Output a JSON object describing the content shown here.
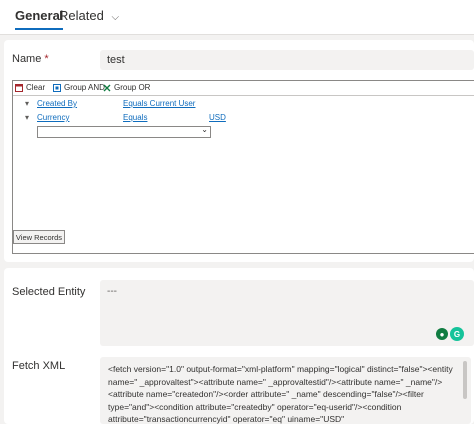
{
  "tabs": {
    "general": "General",
    "related": "Related",
    "related_chevron": "chevron-down-icon"
  },
  "name_field": {
    "label": "Name",
    "required_mark": "*",
    "value": "test"
  },
  "fetch_builder": {
    "toolbar": {
      "clear": "Clear",
      "group_and": "Group AND",
      "group_or": "Group OR"
    },
    "conditions": [
      {
        "field": "Created By",
        "operator": "Equals Current User",
        "value": ""
      },
      {
        "field": "Currency",
        "operator": "Equals",
        "value": "USD"
      }
    ],
    "view_records": "View Records"
  },
  "selected_entity": {
    "label": "Selected Entity",
    "value": "---"
  },
  "fetch_xml": {
    "label": "Fetch XML",
    "value": "<fetch version=\"1.0\" output-format=\"xml-platform\" mapping=\"logical\" distinct=\"false\"><entity name=\"      _approvaltest\"><attribute name=\"      _approvaltestid\"/><attribute name=\"      _name\"/><attribute name=\"createdon\"/><order attribute=\"      _name\" descending=\"false\"/><filter type=\"and\"><condition attribute=\"createdby\" operator=\"eq-userid\"/><condition attribute=\"transactioncurrencyid\" operator=\"eq\" uiname=\"USD\""
  },
  "colors": {
    "accent": "#0f6cbd",
    "copilot_green": "#107c41",
    "grammarly_green": "#15c39a"
  }
}
